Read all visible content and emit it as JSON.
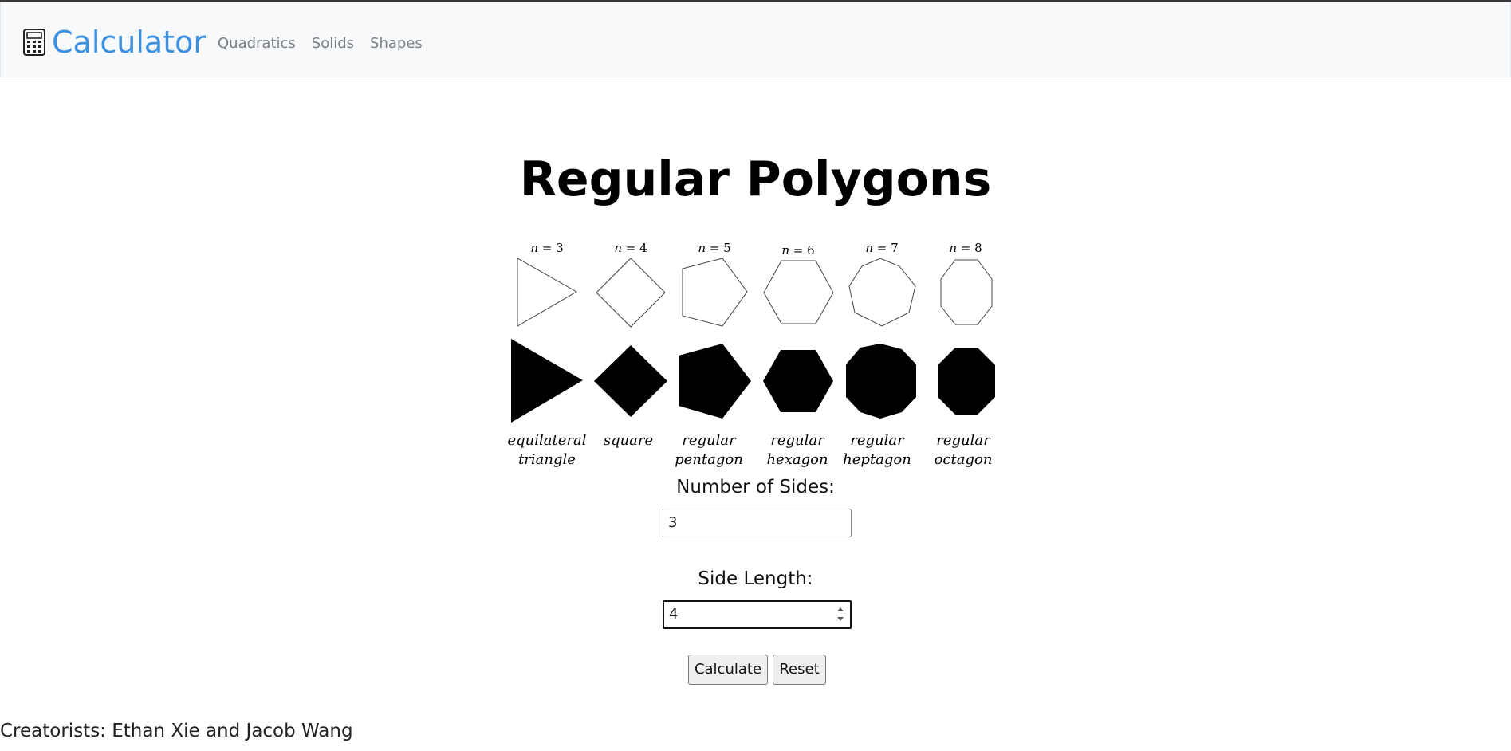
{
  "navbar": {
    "brand": "Calculator",
    "brand_icon": "calculator-icon",
    "links": [
      "Quadratics",
      "Solids",
      "Shapes"
    ]
  },
  "page": {
    "title": "Regular Polygons"
  },
  "figure": {
    "polygons": [
      {
        "n": "3",
        "caption1": "equilateral",
        "caption2": "triangle"
      },
      {
        "n": "4",
        "caption1": "square",
        "caption2": ""
      },
      {
        "n": "5",
        "caption1": "regular",
        "caption2": "pentagon"
      },
      {
        "n": "6",
        "caption1": "regular",
        "caption2": "hexagon"
      },
      {
        "n": "7",
        "caption1": "regular",
        "caption2": "heptagon"
      },
      {
        "n": "8",
        "caption1": "regular",
        "caption2": "octagon"
      }
    ]
  },
  "form": {
    "sides_label": "Number of Sides:",
    "sides_value": "3",
    "length_label": "Side Length:",
    "length_value": "4",
    "calculate_label": "Calculate",
    "reset_label": "Reset"
  },
  "footer": {
    "credits": "Creatorists: Ethan Xie and Jacob Wang"
  },
  "colors": {
    "brand": "#3d8fe0",
    "navbar_bg": "#f8f9fa",
    "nav_link": "#7b7f84"
  }
}
